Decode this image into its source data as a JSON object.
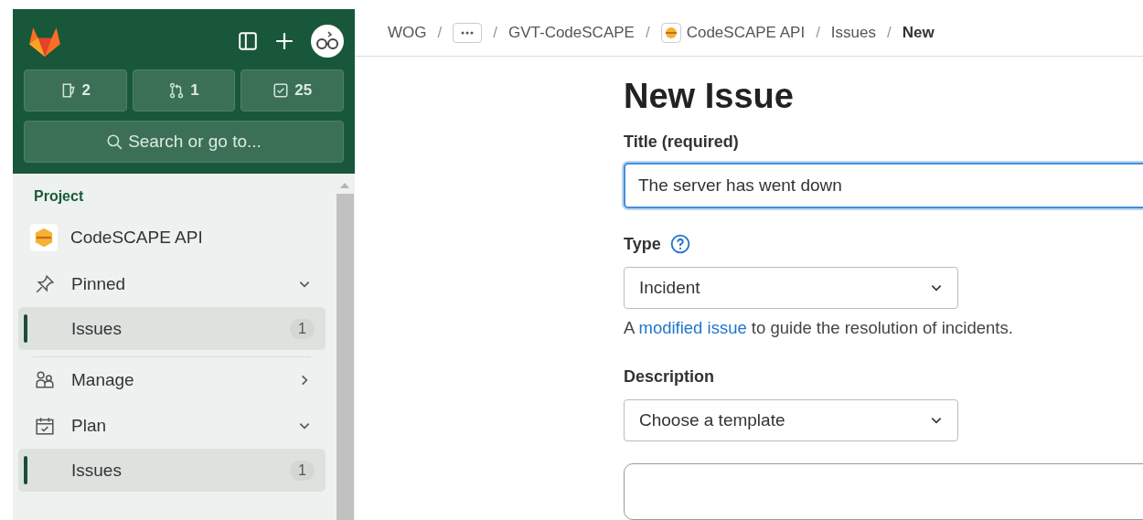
{
  "top_counts": [
    {
      "kind": "issues",
      "count": "2"
    },
    {
      "kind": "merge-requests",
      "count": "1"
    },
    {
      "kind": "todos",
      "count": "25"
    }
  ],
  "search": {
    "placeholder": "Search or go to..."
  },
  "sidebar": {
    "heading": "Project",
    "project": "CodeSCAPE API",
    "items": [
      {
        "kind": "pinned",
        "label": "Pinned",
        "expanded": true,
        "children": [
          {
            "label": "Issues",
            "count": "1",
            "selected": true
          }
        ]
      },
      {
        "kind": "manage",
        "label": "Manage",
        "expanded": false
      },
      {
        "kind": "plan",
        "label": "Plan",
        "expanded": true,
        "children": [
          {
            "label": "Issues",
            "count": "1",
            "selected": true
          }
        ]
      }
    ]
  },
  "breadcrumbs": [
    {
      "kind": "text",
      "label": "WOG"
    },
    {
      "kind": "more",
      "separator": "/"
    },
    {
      "kind": "text",
      "label": "GVT-CodeSCAPE",
      "separator": "/"
    },
    {
      "kind": "project",
      "label": "CodeSCAPE API",
      "separator": "/"
    },
    {
      "kind": "text",
      "label": "Issues",
      "separator": "/"
    },
    {
      "kind": "current",
      "label": "New",
      "separator": "/"
    }
  ],
  "page_title": "New Issue",
  "title_field": {
    "label": "Title (required)",
    "value": "The server has went down"
  },
  "type_field": {
    "label": "Type",
    "value": "Incident",
    "help_before": "A ",
    "help_link": "modified issue",
    "help_after": " to guide the resolution of incidents."
  },
  "description": {
    "label": "Description",
    "template": "Choose a template"
  }
}
